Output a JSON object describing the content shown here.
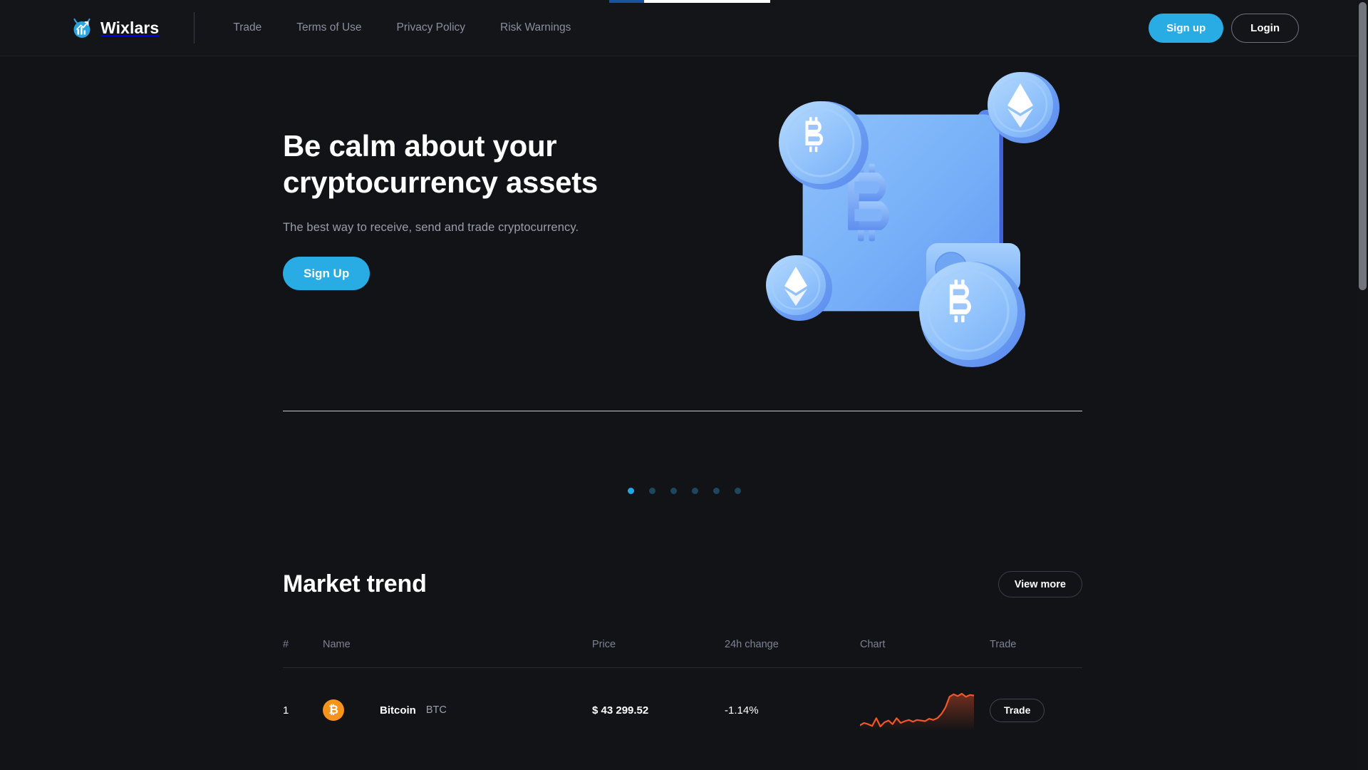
{
  "browser": {
    "progress_percent": 22
  },
  "header": {
    "brand": {
      "name": "Wixlars",
      "logo_icon": "chart-arrow-logo-icon"
    },
    "nav": [
      {
        "label": "Trade"
      },
      {
        "label": "Terms of Use"
      },
      {
        "label": "Privacy Policy"
      },
      {
        "label": "Risk Warnings"
      }
    ],
    "actions": {
      "signup_label": "Sign up",
      "login_label": "Login"
    }
  },
  "hero": {
    "title_line1": "Be calm about your",
    "title_line2": "cryptocurrency assets",
    "subtitle": "The best way to receive, send and trade cryptocurrency.",
    "cta_label": "Sign Up",
    "illustration": "3d-crypto-wallet-with-bitcoin-and-ethereum-coins"
  },
  "carousel": {
    "total": 6,
    "active_index": 0
  },
  "market": {
    "title": "Market trend",
    "view_more_label": "View more",
    "columns": [
      "#",
      "Name",
      "Price",
      "24h change",
      "Chart",
      "Trade"
    ],
    "rows": [
      {
        "rank": "1",
        "icon": "bitcoin-icon",
        "icon_color": "#f7931a",
        "icon_glyph": "₿",
        "name": "Bitcoin",
        "symbol": "BTC",
        "price": "$ 43 299.52",
        "change": "-1.14%",
        "change_direction": "down",
        "trade_label": "Trade",
        "sparkline_color": "#f0562a"
      }
    ]
  },
  "colors": {
    "page_background": "#121316",
    "accent": "#29ace4",
    "accent_dot": "#20a7e8",
    "text_primary": "#ffffff",
    "text_muted": "#8a8fa0",
    "negative": "#e2483f",
    "bitcoin_orange": "#f7931a"
  },
  "chart_data": {
    "type": "line",
    "title": "BTC 24h sparkline",
    "xlabel": "",
    "ylabel": "",
    "grid": false,
    "legend": "none",
    "series": [
      {
        "name": "BTC",
        "color": "#f0562a",
        "values": [
          22,
          26,
          24,
          21,
          34,
          20,
          27,
          30,
          24,
          34,
          26,
          29,
          31,
          28,
          31,
          30,
          29,
          33,
          31,
          34,
          41,
          52,
          70,
          74,
          71,
          75,
          70,
          73,
          72
        ]
      }
    ],
    "ylim": [
      0,
      100
    ]
  }
}
